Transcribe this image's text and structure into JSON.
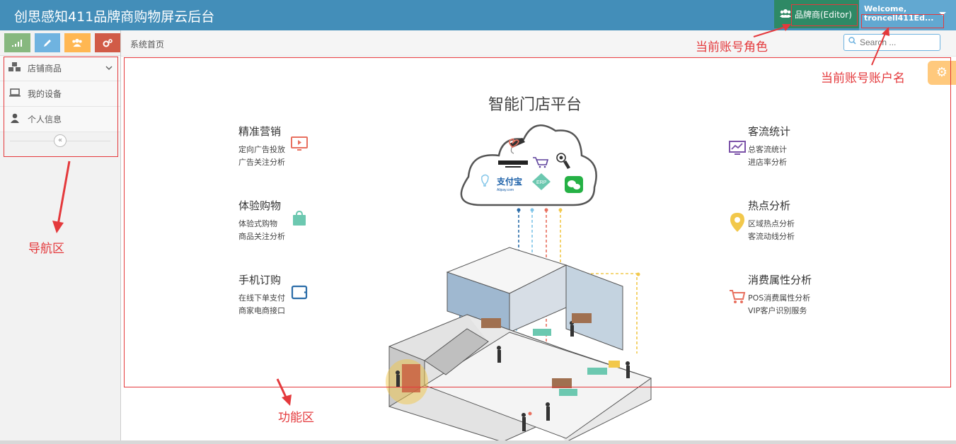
{
  "header": {
    "app_title": "创思感知411品牌商购物屏云后台",
    "role_label": "品牌商(Editor)",
    "welcome": "Welcome,",
    "username": "troncell411Ed..."
  },
  "sidebar": {
    "shortcuts": [
      "signal-icon",
      "pencil-icon",
      "users-icon",
      "cogs-icon"
    ],
    "items": [
      {
        "label": "店铺商品",
        "icon": "cubes-icon"
      },
      {
        "label": "我的设备",
        "icon": "laptop-icon"
      },
      {
        "label": "个人信息",
        "icon": "user-icon"
      }
    ],
    "collapse_icon": "double-left-icon"
  },
  "breadcrumb": {
    "home": "系统首页"
  },
  "search": {
    "placeholder": "Search ..."
  },
  "main": {
    "title": "智能门店平台",
    "features_left": [
      {
        "title": "精准营销",
        "lines": [
          "定向广告投放",
          "广告关注分析"
        ],
        "icon": "screen-play-icon"
      },
      {
        "title": "体验购物",
        "lines": [
          "体验式购物",
          "商品关注分析"
        ],
        "icon": "shopping-bag-icon"
      },
      {
        "title": "手机订购",
        "lines": [
          "在线下单支付",
          "商家电商接口"
        ],
        "icon": "tablet-icon"
      }
    ],
    "features_right": [
      {
        "title": "客流统计",
        "lines": [
          "总客流统计",
          "进店率分析"
        ],
        "icon": "monitor-chart-icon"
      },
      {
        "title": "热点分析",
        "lines": [
          "区域热点分析",
          "客流动线分析"
        ],
        "icon": "location-pin-icon"
      },
      {
        "title": "消费属性分析",
        "lines": [
          "POS消费属性分析",
          "VIP客户识别服务"
        ],
        "icon": "cart-icon"
      }
    ],
    "cloud_labels": {
      "alipay": "支付宝",
      "erp": "ERP"
    }
  },
  "annotations": {
    "role": "当前账号角色",
    "account": "当前账号账户名",
    "nav": "导航区",
    "func": "功能区"
  },
  "colors": {
    "topbar": "#438eb9",
    "role_bg": "#2e8965",
    "annotation": "#e4393c"
  }
}
